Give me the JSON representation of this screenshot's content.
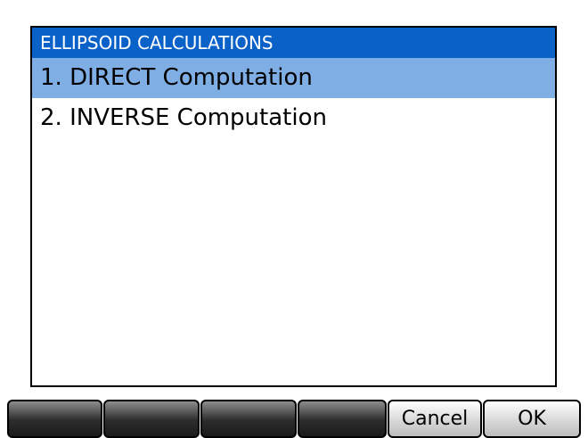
{
  "dialog": {
    "title": "ELLIPSOID CALCULATIONS",
    "items": [
      {
        "label": "1. DIRECT Computation",
        "selected": true
      },
      {
        "label": "2. INVERSE Computation",
        "selected": false
      }
    ]
  },
  "softkeys": [
    {
      "label": ""
    },
    {
      "label": ""
    },
    {
      "label": ""
    },
    {
      "label": ""
    },
    {
      "label": "Cancel"
    },
    {
      "label": "OK"
    }
  ],
  "colors": {
    "title_bar": "#0a62c8",
    "selection": "#7faee4",
    "softkey_dark": "#2c2c2c",
    "softkey_light": "#d8d8d8"
  }
}
